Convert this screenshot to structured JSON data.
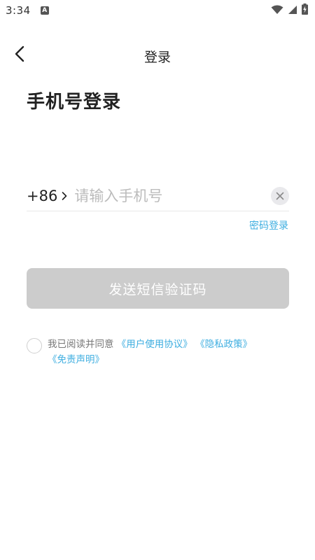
{
  "status_bar": {
    "time": "3:34",
    "notification_letter": "A",
    "icons": [
      "wifi-icon",
      "signal-icon",
      "battery-charging-icon"
    ]
  },
  "app_bar": {
    "title": "登录",
    "back_icon": "chevron-left-icon"
  },
  "heading": "手机号登录",
  "phone_login": {
    "country_code": "+86",
    "country_chevron_icon": "chevron-right-icon",
    "phone_value": "",
    "phone_placeholder": "请输入手机号",
    "clear_icon": "close-icon",
    "password_login_link": "密码登录"
  },
  "send_code_button": "发送短信验证码",
  "agreement": {
    "checked": false,
    "prefix": "我已阅读并同意",
    "user_agreement": "《用户使用协议》",
    "privacy_policy": "《隐私政策》",
    "disclaimer": "《免责声明》"
  },
  "colors": {
    "link": "#3eaee0",
    "button_disabled": "#cccccc",
    "placeholder": "#bcbcbc",
    "text_primary": "#222222"
  }
}
